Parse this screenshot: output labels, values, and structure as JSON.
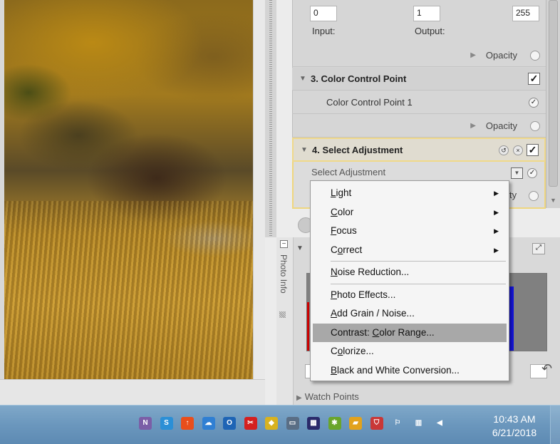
{
  "levels": {
    "input_value": "0",
    "output_value": "1",
    "max_value": "255",
    "input_label": "Input:",
    "output_label": "Output:"
  },
  "rows": {
    "opacity_label": "Opacity",
    "color_control_header": "3. Color Control Point",
    "color_control_item": "Color Control Point 1",
    "select_adjustment_header": "4. Select Adjustment",
    "select_adjustment_dropdown": "Select Adjustment",
    "opacity_partial": "ty"
  },
  "side": {
    "photo_info_label": "Photo Info"
  },
  "watch_points": "Watch Points",
  "menu": {
    "items": [
      {
        "prefix": "",
        "u": "L",
        "rest": "ight",
        "submenu": true
      },
      {
        "prefix": "",
        "u": "C",
        "rest": "olor",
        "submenu": true
      },
      {
        "prefix": "",
        "u": "F",
        "rest": "ocus",
        "submenu": true
      },
      {
        "prefix": "C",
        "u": "o",
        "rest": "rrect",
        "submenu": true
      },
      {
        "prefix": "",
        "u": "N",
        "rest": "oise Reduction...",
        "submenu": false
      },
      {
        "prefix": "",
        "u": "P",
        "rest": "hoto Effects...",
        "submenu": false
      },
      {
        "prefix": "",
        "u": "A",
        "rest": "dd Grain / Noise...",
        "submenu": false
      },
      {
        "prefix": "Contrast: ",
        "u": "C",
        "rest": "olor Range...",
        "submenu": false
      },
      {
        "prefix": "C",
        "u": "o",
        "rest": "lorize...",
        "submenu": false
      },
      {
        "prefix": "",
        "u": "B",
        "rest": "lack and White Conversion...",
        "submenu": false
      }
    ],
    "hovered_index": 7
  },
  "taskbar": {
    "time": "10:43 AM",
    "date": "6/21/2018",
    "tray_icons": [
      "nx-icon",
      "skype-icon",
      "upload-icon",
      "cloud-icon",
      "outlook-icon",
      "snip-icon",
      "shield-icon",
      "drive-icon",
      "calendar-icon",
      "puzzle-icon",
      "folder-icon",
      "security-icon",
      "flag-icon",
      "network-icon",
      "volume-icon"
    ]
  },
  "colors": {
    "selected_border": "#efd67e",
    "menu_hover": "#a8a8a8",
    "histogram_blue": "#1414e0",
    "taskbar": "#6b97bd"
  }
}
